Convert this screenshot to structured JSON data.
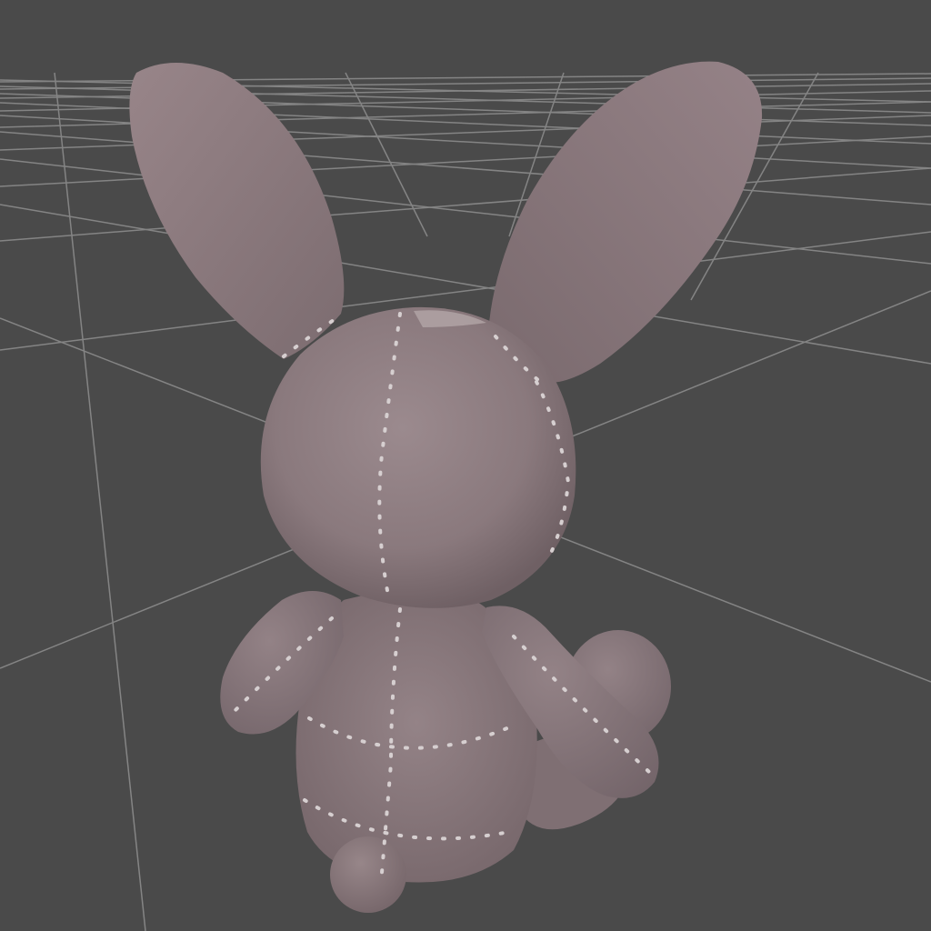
{
  "viewport": {
    "background_color": "#4a4a4a",
    "grid_color": "#9a9a9a",
    "grid_visible": true
  },
  "model": {
    "subject": "stuffed-bunny",
    "view": "back",
    "body_color": "#8c7b7f",
    "stitch_color": "#d9d3d4"
  }
}
